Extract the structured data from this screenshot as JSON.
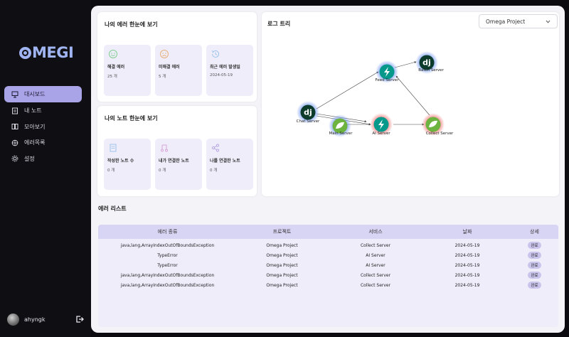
{
  "sidebar": {
    "logo_text": "MEGI",
    "items": [
      {
        "label": "대시보드",
        "icon": "dashboard-icon"
      },
      {
        "label": "내 노트",
        "icon": "note-icon"
      },
      {
        "label": "모아보기",
        "icon": "collection-icon"
      },
      {
        "label": "에러목록",
        "icon": "bug-icon"
      },
      {
        "label": "설정",
        "icon": "gear-icon"
      }
    ],
    "user": {
      "name": "ahyngk"
    }
  },
  "errors_summary": {
    "title": "나의 에러 한눈에 보기",
    "stats": [
      {
        "label": "해결 에러",
        "value": "25 개",
        "icon": "smile-icon",
        "color": "#7fcf8e"
      },
      {
        "label": "미해결 에러",
        "value": "5 개",
        "icon": "frown-icon",
        "color": "#e8b07a"
      },
      {
        "label": "최근 에러 발생일",
        "value": "2024-05-19",
        "icon": "history-icon",
        "color": "#9ec3ea"
      }
    ]
  },
  "notes_summary": {
    "title": "나의 노트 한눈에 보기",
    "stats": [
      {
        "label": "작성한 노트 수",
        "value": "0 개",
        "icon": "document-icon",
        "color": "#9ec3ea"
      },
      {
        "label": "내가 연결한 노트",
        "value": "0 개",
        "icon": "music-link-icon",
        "color": "#d9a8d8"
      },
      {
        "label": "나를 연결한 노트",
        "value": "0 개",
        "icon": "share-icon",
        "color": "#b8a8e8"
      }
    ]
  },
  "log_tree": {
    "title": "로그 트리",
    "project_select": "Omega Project",
    "nodes": [
      {
        "id": "chat",
        "label": "Chat Server",
        "type": "django",
        "glow": "#8aa8f0"
      },
      {
        "id": "main",
        "label": "Main Server",
        "type": "spring",
        "glow": "#8aa8f0"
      },
      {
        "id": "ai",
        "label": "AI Server",
        "type": "fastapi",
        "glow": "#f08a8a"
      },
      {
        "id": "feed",
        "label": "Feed Server",
        "type": "fastapi",
        "glow": "#8aa8f0"
      },
      {
        "id": "batch",
        "label": "Batch Server",
        "type": "django",
        "glow": "#8aa8f0"
      },
      {
        "id": "collect",
        "label": "Collect Server",
        "type": "spring",
        "glow": "#f08a8a"
      }
    ]
  },
  "error_list": {
    "title": "에러 리스트",
    "columns": [
      "에러 종류",
      "프로젝트",
      "서비스",
      "날짜",
      "상세"
    ],
    "rows": [
      {
        "type": "java,lang,ArrayIndexOutOfBoundsException",
        "project": "Omega Project",
        "service": "Collect Server",
        "date": "2024-05-19",
        "detail": "완료"
      },
      {
        "type": "TypeError",
        "project": "Omega Project",
        "service": "AI Server",
        "date": "2024-05-19",
        "detail": "완료"
      },
      {
        "type": "TypeError",
        "project": "Omega Project",
        "service": "AI Server",
        "date": "2024-05-19",
        "detail": "완료"
      },
      {
        "type": "java,lang,ArrayIndexOutOfBoundsException",
        "project": "Omega Project",
        "service": "Collect Server",
        "date": "2024-05-19",
        "detail": "완료"
      },
      {
        "type": "java,lang,ArrayIndexOutOfBoundsException",
        "project": "Omega Project",
        "service": "Collect Server",
        "date": "2024-05-19",
        "detail": "완료"
      }
    ]
  }
}
